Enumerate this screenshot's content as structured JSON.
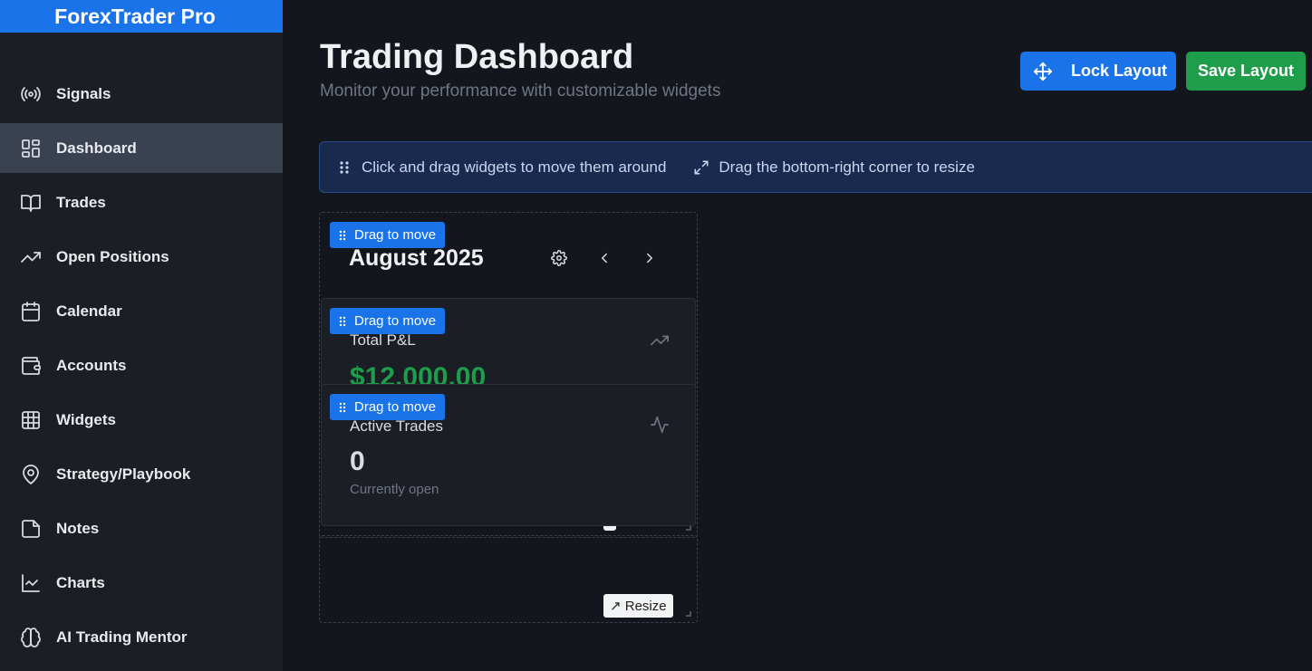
{
  "app": {
    "title": "ForexTrader Pro"
  },
  "sidebar": {
    "items": [
      {
        "label": "Signals",
        "icon": "signal-icon"
      },
      {
        "label": "Dashboard",
        "icon": "dashboard-icon",
        "active": true
      },
      {
        "label": "Trades",
        "icon": "book-icon"
      },
      {
        "label": "Open Positions",
        "icon": "trending-up-icon"
      },
      {
        "label": "Calendar",
        "icon": "calendar-icon"
      },
      {
        "label": "Accounts",
        "icon": "wallet-icon"
      },
      {
        "label": "Widgets",
        "icon": "grid-icon"
      },
      {
        "label": "Strategy/Playbook",
        "icon": "map-pin-icon"
      },
      {
        "label": "Notes",
        "icon": "note-icon"
      },
      {
        "label": "Charts",
        "icon": "chart-icon"
      },
      {
        "label": "AI Trading Mentor",
        "icon": "brain-icon"
      }
    ]
  },
  "header": {
    "title": "Trading Dashboard",
    "subtitle": "Monitor your performance with customizable widgets",
    "lock_label": "Lock Layout",
    "save_label": "Save Layout"
  },
  "banner": {
    "drag_text": "Click and drag widgets to move them around",
    "resize_text": "Drag the bottom-right corner to resize"
  },
  "widgets": {
    "drag_label": "Drag to move",
    "resize_label": "↗ Resize",
    "calendar": {
      "month": "August 2025"
    },
    "pnl": {
      "label": "Total P&L",
      "value": "$12,000.00"
    },
    "active": {
      "label": "Active Trades",
      "value": "0",
      "sub": "Currently open"
    }
  },
  "colors": {
    "accent": "#1a73e8",
    "success": "#1e9e4a",
    "sidebar_bg": "#1b1e24",
    "page_bg": "#13161c"
  }
}
